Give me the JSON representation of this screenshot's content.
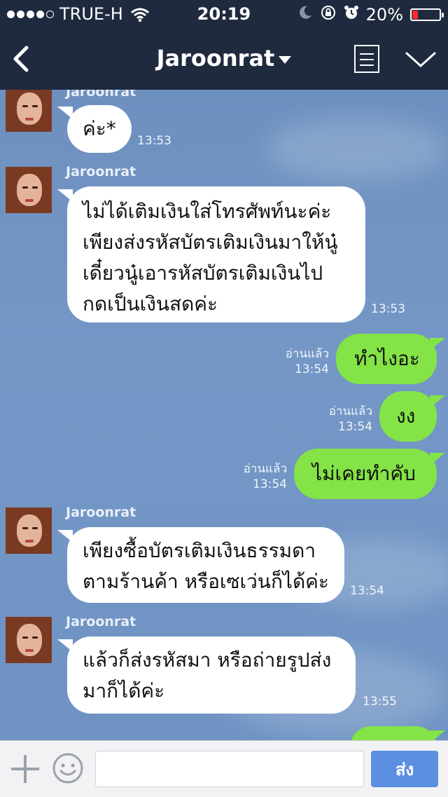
{
  "status_bar": {
    "carrier": "TRUE-H",
    "time": "20:19",
    "battery": "20%",
    "battery_level": 0.2,
    "signal_bars": 4,
    "battery_color": "#ff2b2b"
  },
  "nav": {
    "back_icon": "chevron-left-icon",
    "title": "Jaroonrat",
    "menu_icon": "list-icon",
    "collapse_icon": "chevron-down-icon"
  },
  "chat": {
    "messages": [
      {
        "side": "in",
        "sender": "Jaroonrat",
        "text": "ค่ะ*",
        "time": "13:53"
      },
      {
        "side": "in",
        "sender": "Jaroonrat",
        "lines": [
          "ไม่ได้เติมเงินใส่โทรศัพท์นะค่ะ",
          "เพียงส่งรหัสบัตรเติมเงินมาให้นู๋",
          "เดี๋ยวนู๋เอารหัสบัตรเติมเงินไป",
          "กดเป็นเงินสดค่ะ"
        ],
        "time": "13:53"
      },
      {
        "side": "out",
        "read": "อ่านแล้ว",
        "text": "ทำไงอะ",
        "time": "13:54"
      },
      {
        "side": "out",
        "read": "อ่านแล้ว",
        "text": "งง",
        "time": "13:54"
      },
      {
        "side": "out",
        "read": "อ่านแล้ว",
        "text": "ไม่เคยทำคับ",
        "time": "13:54"
      },
      {
        "side": "in",
        "sender": "Jaroonrat",
        "lines": [
          "เพียงซื้อบัตรเติมเงินธรรมดา",
          "ตามร้านค้า หรือเซเว่นก็ได้ค่ะ"
        ],
        "time": "13:54"
      },
      {
        "side": "in",
        "sender": "Jaroonrat",
        "lines": [
          "แล้วก็ส่งรหัสมา หรือถ่ายรูปส่ง",
          "มาก็ได้ค่ะ"
        ],
        "time": "13:55"
      }
    ]
  },
  "input_bar": {
    "plus_icon": "plus-icon",
    "emoji_icon": "smiley-icon",
    "message_value": "",
    "send_label": "ส่ง"
  },
  "colors": {
    "nav_bg": "#1f2a3f",
    "chat_bg": "#6f93c2",
    "outgoing_bubble": "#84e346",
    "incoming_bubble": "#ffffff",
    "send_button": "#5b8fe0"
  }
}
